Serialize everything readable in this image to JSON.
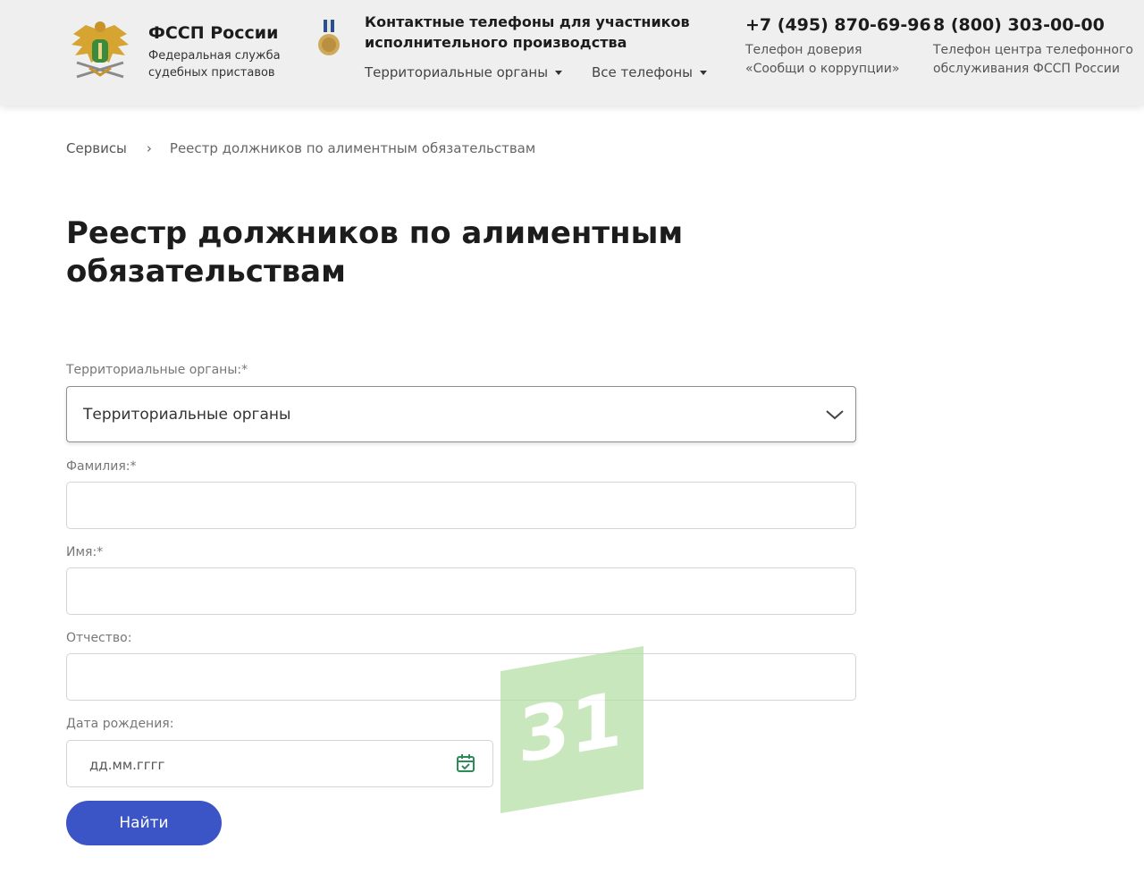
{
  "header": {
    "logo_title": "ФССП России",
    "logo_subtitle": "Федеральная служба судебных приставов",
    "contact_title": "Контактные телефоны для участников исполнительного производства",
    "dropdown_territorial": "Территориальные органы",
    "dropdown_all_phones": "Все телефоны",
    "phone_trust": "+7 (495) 870-69-96",
    "phone_trust_desc": "Телефон доверия «Сообщи о коррупции»",
    "phone_center": "8 (800) 303-00-00",
    "phone_center_desc": "Телефон центра телефонного обслуживания ФССП России"
  },
  "breadcrumb": {
    "services": "Сервисы",
    "separator": "›",
    "current": "Реестр должников по алиментным обязательствам"
  },
  "page_title": "Реестр должников по алиментным обязательствам",
  "form": {
    "territorial_label": "Территориальные органы:*",
    "territorial_value": "Территориальные органы",
    "surname_label": "Фамилия:*",
    "surname_value": "",
    "name_label": "Имя:*",
    "name_value": "",
    "patronymic_label": "Отчество:",
    "patronymic_value": "",
    "birthdate_label": "Дата рождения:",
    "birthdate_placeholder": "дд.мм.гггг",
    "submit_label": "Найти"
  },
  "colors": {
    "accent": "#3b55c6",
    "calendar_icon": "#2e8b57",
    "watermark": "#b7dfa6"
  },
  "icons": {
    "emblem": "fssp-emblem-icon",
    "medal": "medal-icon",
    "chevron": "chevron-down-icon",
    "calendar": "calendar-check-icon"
  },
  "watermark": {
    "text": "31"
  }
}
